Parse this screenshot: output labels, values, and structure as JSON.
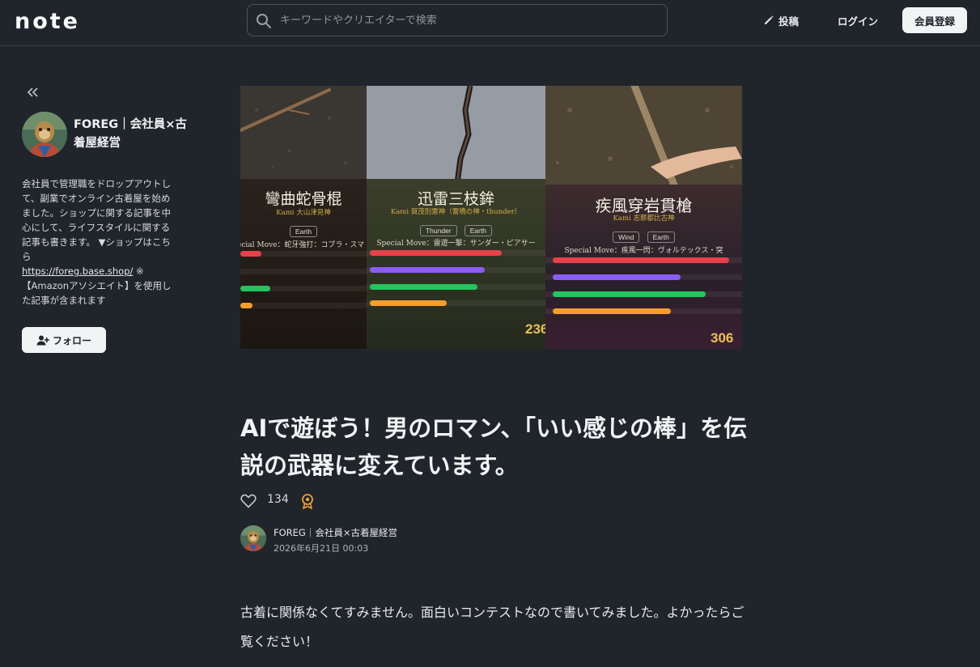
{
  "header": {
    "logo": "note",
    "search_placeholder": "キーワードやクリエイターで検索",
    "post_label": "投稿",
    "login_label": "ログイン",
    "signup_label": "会員登録"
  },
  "sidebar": {
    "author_name": "FOREG｜会社員×古着屋経営",
    "bio_text": "会社員で管理職をドロップアウトして、副業でオンライン古着屋を始めました。ショップに関する記事を中心にして、ライフスタイルに関する記事も書きます。 ▼ショップはこちら",
    "bio_link": "https://foreg.base.shop/",
    "bio_tail": "※【Amazonアソシエイト】を使用した記事が含まれます",
    "follow_label": "フォロー"
  },
  "hero": {
    "cards": [
      {
        "title": "彎曲蛇骨棍",
        "kami": "Kami 大山津見神",
        "tags": [
          "Earth"
        ],
        "special": "ecial Move：蛇牙強打：コブラ・スマ",
        "bars": [
          0.17,
          0.24,
          0.1
        ],
        "score": ""
      },
      {
        "title": "迅雷三枝鉾",
        "kami": "Kami 賀茂別雷神（雷鳴の神・thunder）",
        "tags": [
          "Thunder",
          "Earth"
        ],
        "special": "Special Move：雷遊一撃：サンダー・ピアサー",
        "bars": [
          0.75,
          0.66,
          0.6,
          0.44
        ],
        "score": "236"
      },
      {
        "title": "疾風穿岩貫槍",
        "kami": "Kami 志那都比古神",
        "tags": [
          "Wind",
          "Earth"
        ],
        "special": "Special Move：疾風一閃：ヴォルテックス・突",
        "bars": [
          0.9,
          0.65,
          0.78,
          0.6
        ],
        "score": "306"
      }
    ]
  },
  "article": {
    "title": "AIで遊ぼう！男のロマン、「いい感じの棒」を伝説の武器に変えています。",
    "like_count": "134",
    "author": "FOREG｜会社員×古着屋経営",
    "date": "2026年6月21日 00:03",
    "body": "古着に関係なくてすみません。面白いコンテストなので書いてみました。よかったらご覧ください！"
  },
  "colors": {
    "background": "#1f252b",
    "bar_red": "#e8414a",
    "bar_purple": "#8b5cf6",
    "bar_green": "#22c55e",
    "bar_orange": "#f59e2c",
    "score_gold": "#e9c25a"
  }
}
